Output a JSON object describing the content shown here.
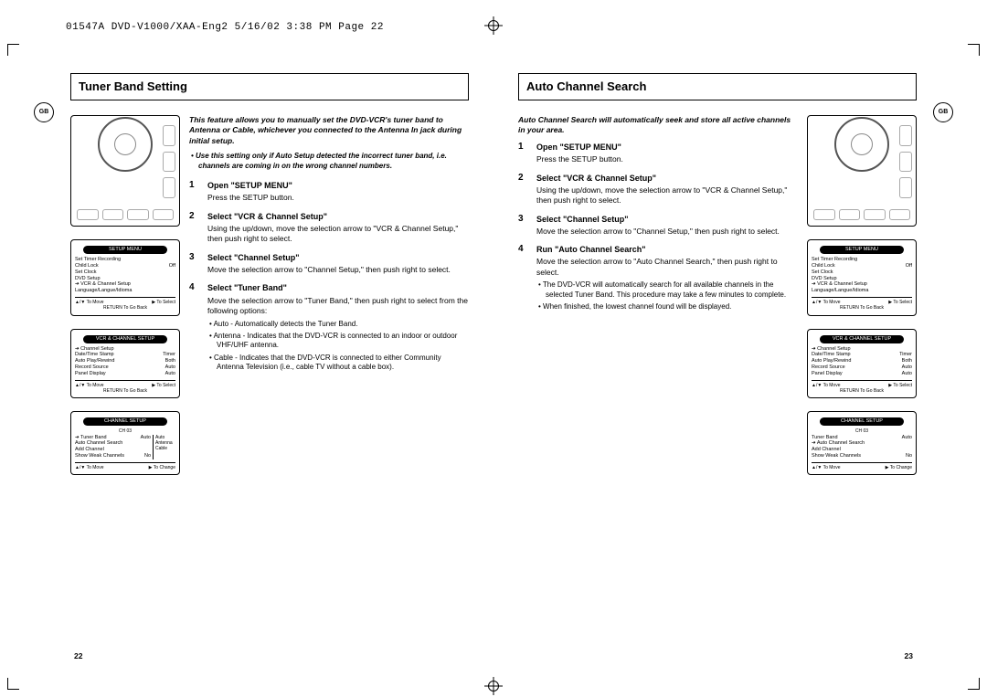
{
  "header": "01547A DVD-V1000/XAA-Eng2  5/16/02 3:38 PM  Page 22",
  "gb_label": "GB",
  "left": {
    "title": "Tuner Band Setting",
    "intro": "This feature allows you to manually set the DVD-VCR's tuner band to Antenna or Cable, whichever you connected to the Antenna In jack during initial setup.",
    "note": "• Use this setting only if Auto Setup detected the incorrect tuner band, i.e. channels are coming in on the wrong channel numbers.",
    "steps": [
      {
        "num": "1",
        "title": "Open \"SETUP MENU\"",
        "body": "Press the SETUP button."
      },
      {
        "num": "2",
        "title": "Select \"VCR & Channel Setup\"",
        "body": "Using the up/down, move the selection arrow to \"VCR & Channel Setup,\" then push right to select."
      },
      {
        "num": "3",
        "title": "Select \"Channel Setup\"",
        "body": "Move the selection arrow to \"Channel Setup,\" then push right to select."
      },
      {
        "num": "4",
        "title": "Select \"Tuner Band\"",
        "body": "Move the selection arrow to \"Tuner Band,\" then push right to select from the following options:",
        "opts": [
          "• Auto - Automatically detects the Tuner Band.",
          "• Antenna - Indicates that the DVD-VCR is connected to an indoor or outdoor VHF/UHF antenna.",
          "• Cable - Indicates that the DVD-VCR is connected to either Community Antenna Television (i.e., cable TV without a cable box)."
        ]
      }
    ],
    "page_num": "22",
    "figs": {
      "setup_menu": {
        "title": "SETUP MENU",
        "rows": [
          [
            "Set Timer Recording",
            ""
          ],
          [
            "Child Lock",
            "Off"
          ],
          [
            "Set Clock",
            ""
          ],
          [
            "DVD Setup",
            ""
          ],
          [
            "➔ VCR & Channel Setup",
            ""
          ],
          [
            "Language/Langue/Idioma",
            ""
          ]
        ],
        "foot_l": "▲/▼ To  Move",
        "foot_r": "▶ To Select",
        "sub": "RETURN To Go Back"
      },
      "vcr_setup": {
        "title": "VCR & CHANNEL SETUP",
        "rows": [
          [
            "➔ Channel Setup",
            ""
          ],
          [
            "Date/Time Stamp",
            "Timer"
          ],
          [
            "Auto Play/Rewind",
            "Both"
          ],
          [
            "Record Source",
            "Auto"
          ],
          [
            "Panel Display",
            "Auto"
          ]
        ],
        "foot_l": "▲/▼ To  Move",
        "foot_r": "▶ To Select",
        "sub": "RETURN To Go Back"
      },
      "channel_setup": {
        "title": "CHANNEL SETUP",
        "ch": "CH 03",
        "rows": [
          [
            "➔ Tuner Band",
            "Auto"
          ],
          [
            "Auto Channel Search",
            ""
          ],
          [
            "Add Channel",
            ""
          ],
          [
            "Show Weak Channels",
            "No"
          ]
        ],
        "side": [
          "Auto",
          "Antenna",
          "Cable"
        ],
        "foot_l": "▲/▼ To  Move",
        "foot_r": "▶ To Change"
      }
    }
  },
  "right": {
    "title": "Auto Channel Search",
    "intro": "Auto Channel Search will automatically seek and store all active channels in your area.",
    "steps": [
      {
        "num": "1",
        "title": "Open \"SETUP MENU\"",
        "body": "Press the SETUP button."
      },
      {
        "num": "2",
        "title": "Select \"VCR & Channel Setup\"",
        "body": "Using the up/down, move the selection arrow to \"VCR & Channel Setup,\" then push right to select."
      },
      {
        "num": "3",
        "title": "Select \"Channel Setup\"",
        "body": "Move the selection arrow to \"Channel Setup,\" then push right to select."
      },
      {
        "num": "4",
        "title": "Run \"Auto Channel Search\"",
        "body": "Move the selection arrow to \"Auto Channel Search,\" then push right to select.",
        "opts": [
          "• The DVD-VCR will automatically search for all available channels in the selected Tuner Band. This procedure may take a few minutes to complete.",
          "• When finished, the lowest channel found will be displayed."
        ]
      }
    ],
    "page_num": "23",
    "figs": {
      "setup_menu": {
        "title": "SETUP MENU",
        "rows": [
          [
            "Set Timer Recording",
            ""
          ],
          [
            "Child Lock",
            "Off"
          ],
          [
            "Set Clock",
            ""
          ],
          [
            "DVD Setup",
            ""
          ],
          [
            "➔ VCR & Channel Setup",
            ""
          ],
          [
            "Language/Langue/Idioma",
            ""
          ]
        ],
        "foot_l": "▲/▼ To  Move",
        "foot_r": "▶ To Select",
        "sub": "RETURN To Go Back"
      },
      "vcr_setup": {
        "title": "VCR & CHANNEL SETUP",
        "rows": [
          [
            "➔ Channel Setup",
            ""
          ],
          [
            "Date/Time Stamp",
            "Timer"
          ],
          [
            "Auto Play/Rewind",
            "Both"
          ],
          [
            "Record Source",
            "Auto"
          ],
          [
            "Panel Display",
            "Auto"
          ]
        ],
        "foot_l": "▲/▼ To  Move",
        "foot_r": "▶ To Select",
        "sub": "RETURN To Go Back"
      },
      "channel_setup": {
        "title": "CHANNEL SETUP",
        "ch": "CH 03",
        "rows": [
          [
            "Tuner Band",
            "Auto"
          ],
          [
            "➔ Auto Channel Search",
            ""
          ],
          [
            "Add Channel",
            ""
          ],
          [
            "Show Weak Channels",
            "No"
          ]
        ],
        "foot_l": "▲/▼ To  Move",
        "foot_r": "▶ To Change"
      }
    }
  }
}
